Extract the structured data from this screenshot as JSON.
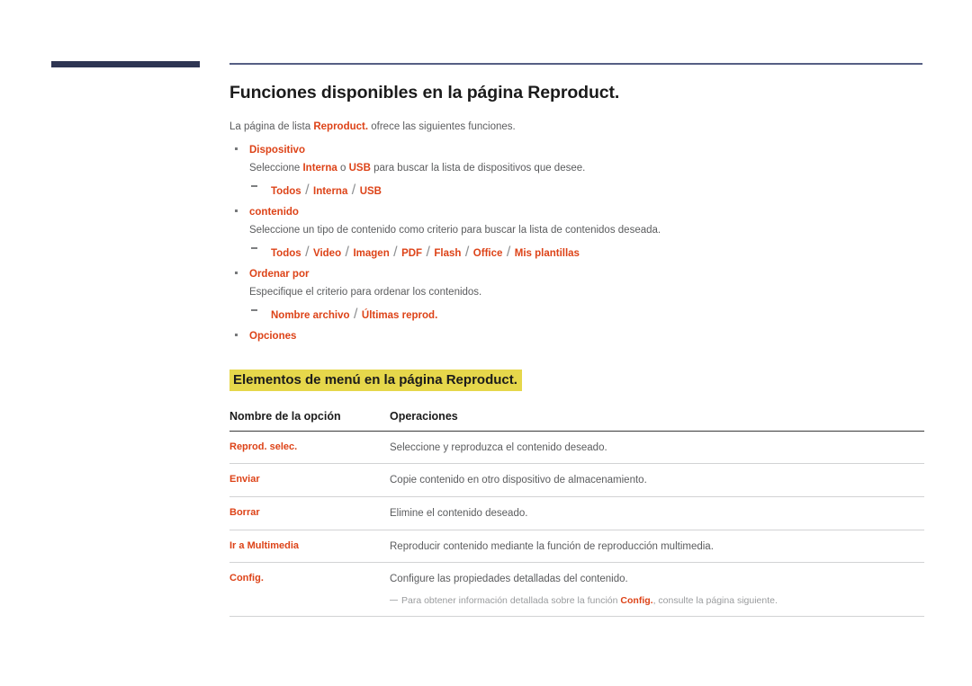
{
  "page": {
    "title": "Funciones disponibles en la página Reproduct.",
    "intro_prefix": "La página de lista ",
    "intro_term": "Reproduct.",
    "intro_suffix": " ofrece las siguientes funciones."
  },
  "bullets": [
    {
      "heading": "Dispositivo",
      "desc_prefix": "Seleccione ",
      "desc_term1": "Interna",
      "desc_mid": " o ",
      "desc_term2": "USB",
      "desc_suffix": " para buscar la lista de dispositivos que desee.",
      "options": [
        "Todos",
        "Interna",
        "USB"
      ]
    },
    {
      "heading": "contenido",
      "desc": "Seleccione un tipo de contenido como criterio para buscar la lista de contenidos deseada.",
      "options": [
        "Todos",
        "Video",
        "Imagen",
        "PDF",
        "Flash",
        "Office",
        "Mis plantillas"
      ]
    },
    {
      "heading": "Ordenar por",
      "desc": "Especifique el criterio para ordenar los contenidos.",
      "options": [
        "Nombre archivo",
        "Últimas reprod."
      ]
    },
    {
      "heading": "Opciones"
    }
  ],
  "section": {
    "highlight_title": "Elementos de menú en la página Reproduct."
  },
  "table": {
    "headers": {
      "name": "Nombre de la opción",
      "operations": "Operaciones"
    },
    "rows": [
      {
        "name": "Reprod. selec.",
        "operation": "Seleccione y reproduzca el contenido deseado."
      },
      {
        "name": "Enviar",
        "operation": "Copie contenido en otro dispositivo de almacenamiento."
      },
      {
        "name": "Borrar",
        "operation": "Elimine el contenido deseado."
      },
      {
        "name": "Ir a Multimedia",
        "operation": "Reproducir contenido mediante la función de reproducción multimedia."
      },
      {
        "name": "Config.",
        "operation": "Configure las propiedades detalladas del contenido.",
        "note_prefix": "Para obtener información detallada sobre la función ",
        "note_term": "Config.",
        "note_suffix": ", consulte la página siguiente."
      }
    ]
  },
  "colors": {
    "accent_red": "#dd4318",
    "highlight_yellow": "#e6d74b",
    "navy_bar": "#2e3553",
    "body_gray": "#5b5c5e"
  }
}
